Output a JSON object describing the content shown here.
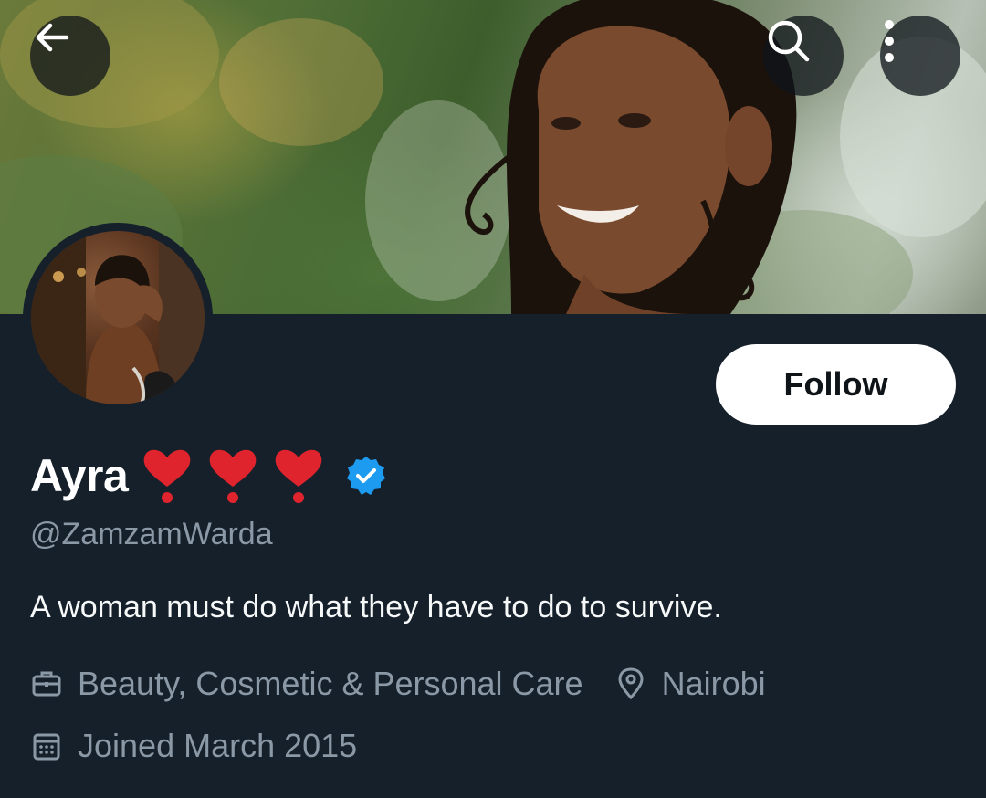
{
  "header": {
    "back_icon": "arrow-left-icon",
    "search_icon": "search-icon",
    "more_icon": "more-vertical-icon"
  },
  "profile": {
    "display_name": "Ayra",
    "name_emojis": [
      "❣️",
      "❣️",
      "❣️"
    ],
    "verified": true,
    "handle": "@ZamzamWarda",
    "bio": "A woman must do what they have to do to survive.",
    "category": "Beauty, Cosmetic & Personal Care",
    "location": "Nairobi",
    "joined": "Joined March 2015"
  },
  "actions": {
    "follow_label": "Follow"
  },
  "colors": {
    "background": "#15202b",
    "secondary_text": "#8b98a5",
    "verified_blue": "#1d9bf0",
    "heart_red": "#e0242e"
  }
}
